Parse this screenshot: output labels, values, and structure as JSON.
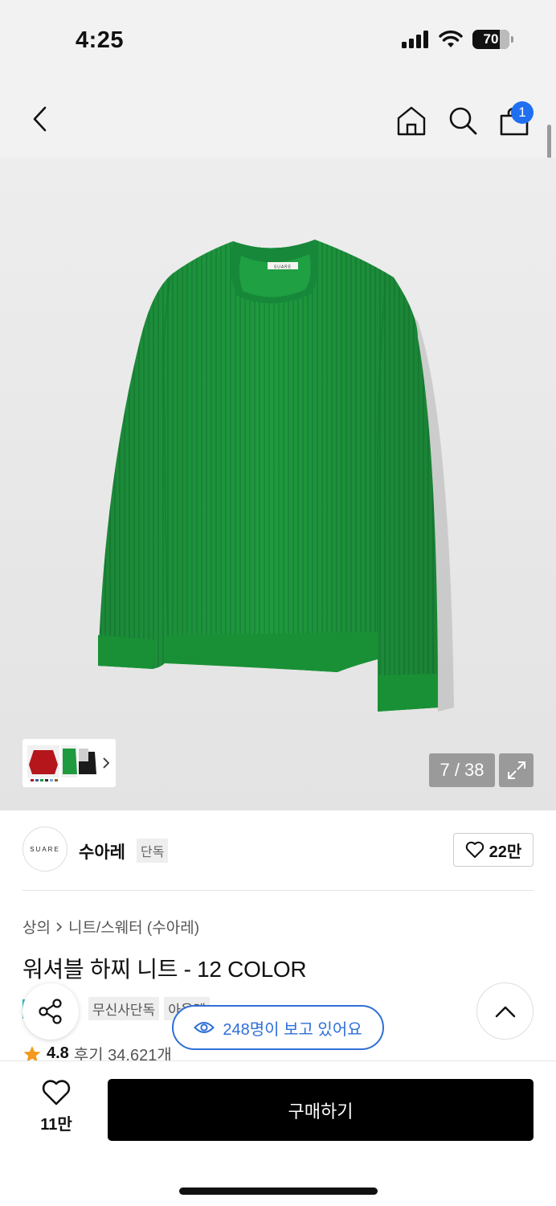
{
  "status_bar": {
    "time": "4:25",
    "battery": "70"
  },
  "nav": {
    "cart_count": "1"
  },
  "gallery": {
    "counter": "7 / 38"
  },
  "brand": {
    "logo_text": "SUARE",
    "name": "수아레",
    "tag": "단독",
    "like_count": "22만"
  },
  "breadcrumb": {
    "category": "상의",
    "subcategory": "니트/스웨터 (수아레)"
  },
  "product": {
    "title": "워셔블 하찌 니트 - 12 COLOR",
    "tags": [
      "무신사단독",
      "아울렛"
    ],
    "rating": "4.8",
    "reviews": "후기 34,621개",
    "sweater_label": "SUARE"
  },
  "viewers": {
    "text": "248명이 보고 있어요"
  },
  "bottom": {
    "wish_count": "11만",
    "buy_label": "구매하기"
  },
  "colors": {
    "accent_blue": "#2f6fd8",
    "badge_blue": "#1f6ff0",
    "sweater_green": "#1f9a3e",
    "star": "#f39a1c"
  }
}
